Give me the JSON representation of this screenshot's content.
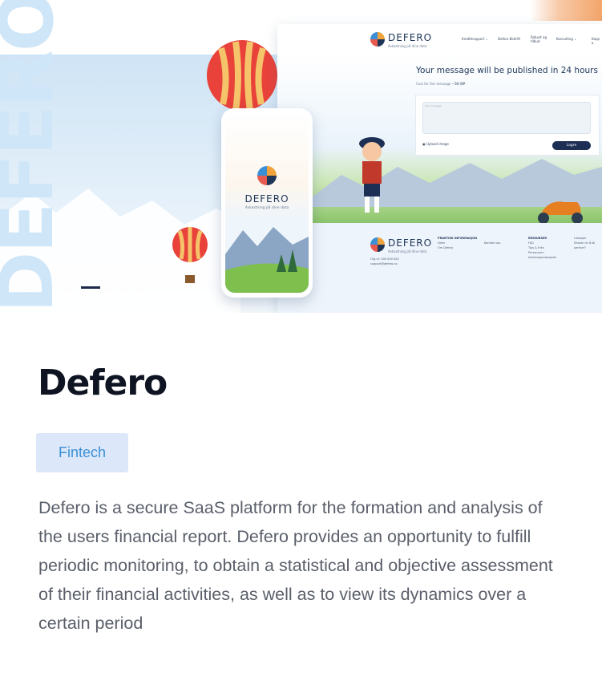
{
  "hero": {
    "watermark": "DEFERO",
    "site": {
      "logo_word": "DEFERO",
      "logo_sub": "Avkastning på dine data",
      "nav": [
        "Kredittrapport ⌄",
        "Defero Bedrift",
        "Robust og tilbud",
        "Konsulting ⌄",
        "Kapp a"
      ],
      "message_title": "Your message will be published in 24 hours",
      "cost_label": "Cost for this message",
      "cost_value": "~50 DP",
      "textarea_placeholder": "Your message",
      "upload_label": "Upload image",
      "save_label": "Lagre",
      "footer": {
        "logo_word": "DEFERO",
        "logo_sub": "Avkastning på dine data",
        "address": "Org.nr: 000 000 000",
        "contact": "support@defero.no",
        "col1_title": "PRAKTISK INFORMASJON",
        "col1_items": [
          "Hjem",
          "Om Defero"
        ],
        "col2_items": [
          "Kontakt oss"
        ],
        "col3_title": "RESSURSER",
        "col3_items": [
          "FAQ",
          "Tips & triks",
          "Personvern",
          "Informasjonskapsler"
        ],
        "col4_items": [
          "Lukasjon",
          "Ønsker du å bli partner?"
        ]
      }
    },
    "phone": {
      "logo_word": "DEFERO",
      "logo_sub": "Avkastning på dine data"
    }
  },
  "project": {
    "title": "Defero",
    "tag": "Fintech",
    "description": "Defero is a secure SaaS platform for the formation and analysis of the users financial report. Defero provides an opportunity to fulfill periodic monitoring, to obtain a statistical and objective assessment of their financial activities, as well as to view its dynamics over a certain period"
  },
  "colors": {
    "accent": "#3b8fd6",
    "tag_bg": "#dce8f9",
    "title": "#0e1422",
    "body_text": "#5a5f6a",
    "navy": "#1d3557"
  }
}
